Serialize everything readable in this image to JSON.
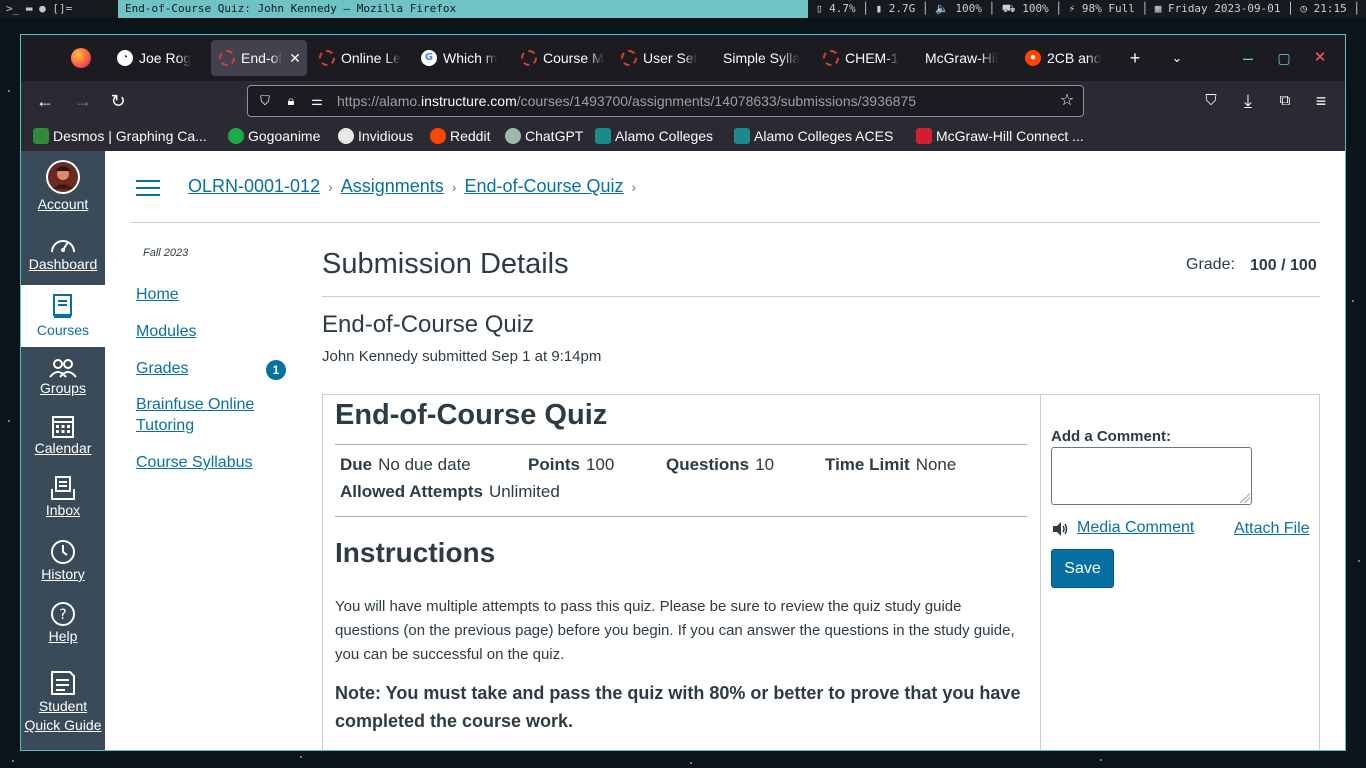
{
  "system_bar": {
    "workspace_glyphs": ">_  ▬  ●  []=",
    "window_title": "End-of-Course Quiz: John Kennedy — Mozilla Firefox",
    "status": "▯ 4.7% │ ▮ 2.7G │ 🔈 100% │ ⛟ 100% │ ⚡ 98% Full │ ▦ Friday 2023-09-01 │ ◷ 21:15 │"
  },
  "browser": {
    "tabs": [
      {
        "label": "Joe Rog",
        "favicon": "joe-icon"
      },
      {
        "label": "End-of",
        "favicon": "canvas-icon",
        "active": true
      },
      {
        "label": "Online Le",
        "favicon": "canvas-icon"
      },
      {
        "label": "Which m",
        "favicon": "google-icon"
      },
      {
        "label": "Course M",
        "favicon": "canvas-icon"
      },
      {
        "label": "User Set",
        "favicon": "canvas-icon"
      },
      {
        "label": "Simple Sylla",
        "favicon": ""
      },
      {
        "label": "CHEM-1",
        "favicon": "canvas-icon"
      },
      {
        "label": "McGraw-Hil",
        "favicon": ""
      },
      {
        "label": "2CB and",
        "favicon": "reddit-icon"
      }
    ],
    "url_prefix": "https://alamo.",
    "url_domain": "instructure.com",
    "url_path": "/courses/1493700/assignments/14078633/submissions/3936875",
    "bookmarks": [
      {
        "label": "Desmos | Graphing Ca...",
        "color": "#2f8a3a"
      },
      {
        "label": "Gogoanime",
        "color": "#1faa4a"
      },
      {
        "label": "Invidious",
        "color": "#e8e8e8"
      },
      {
        "label": "Reddit",
        "color": "#ff4500"
      },
      {
        "label": "ChatGPT",
        "color": "#9fb8ad"
      },
      {
        "label": "Alamo Colleges",
        "color": "#1a8a8a"
      },
      {
        "label": "Alamo Colleges ACES",
        "color": "#1a8a8a"
      },
      {
        "label": "McGraw-Hill Connect ...",
        "color": "#d0202f"
      }
    ]
  },
  "global_nav": {
    "items": [
      {
        "label": "Account",
        "icon": "avatar"
      },
      {
        "label": "Dashboard",
        "icon": "dashboard-icon"
      },
      {
        "label": "Courses",
        "icon": "courses-icon",
        "active": true
      },
      {
        "label": "Groups",
        "icon": "groups-icon"
      },
      {
        "label": "Calendar",
        "icon": "calendar-icon"
      },
      {
        "label": "Inbox",
        "icon": "inbox-icon"
      },
      {
        "label": "History",
        "icon": "history-icon"
      },
      {
        "label": "Help",
        "icon": "help-icon"
      },
      {
        "label": "Student Quick Guide",
        "icon": "guide-icon"
      }
    ]
  },
  "breadcrumbs": [
    "OLRN-0001-012",
    "Assignments",
    "End-of-Course Quiz"
  ],
  "course_nav": {
    "term": "Fall 2023",
    "items": [
      {
        "label": "Home"
      },
      {
        "label": "Modules"
      },
      {
        "label": "Grades",
        "badge": "1"
      },
      {
        "label": "Brainfuse Online Tutoring"
      },
      {
        "label": "Course Syllabus"
      }
    ]
  },
  "submission": {
    "page_title": "Submission Details",
    "grade_label": "Grade:",
    "grade_value": "100 / 100",
    "quiz_heading": "End-of-Course Quiz",
    "submitted_text": "John Kennedy submitted Sep 1 at 9:14pm"
  },
  "quiz": {
    "title": "End-of-Course Quiz",
    "due_label": "Due",
    "due_value": "No due date",
    "points_label": "Points",
    "points_value": "100",
    "questions_label": "Questions",
    "questions_value": "10",
    "time_limit_label": "Time Limit",
    "time_limit_value": "None",
    "attempts_label": "Allowed Attempts",
    "attempts_value": "Unlimited",
    "instructions_heading": "Instructions",
    "instructions_text": "You will have multiple attempts to pass this quiz. Please be sure to review the quiz study guide questions (on the previous page) before you begin. If you can answer the questions in the study guide, you can be successful on the quiz.",
    "note_text": "Note: You must take and pass the quiz with 80% or better to prove that you have completed the course work."
  },
  "comments": {
    "label": "Add a Comment:",
    "media_comment": "Media Comment",
    "attach_file": "Attach File",
    "save": "Save"
  },
  "colors": {
    "canvas_blue": "#0770a3",
    "nav_bg": "#394b58",
    "text": "#2d3b45"
  }
}
